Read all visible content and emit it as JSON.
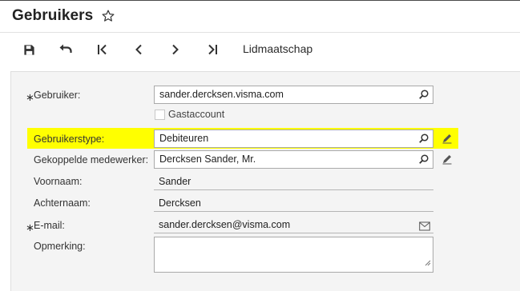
{
  "header": {
    "title": "Gebruikers",
    "star_icon": "star-outline-icon"
  },
  "toolbar": {
    "buttons": [
      {
        "name": "save",
        "icon": "save-icon"
      },
      {
        "name": "undo",
        "icon": "undo-icon"
      },
      {
        "name": "first",
        "icon": "first-record-icon"
      },
      {
        "name": "previous",
        "icon": "previous-record-icon"
      },
      {
        "name": "next",
        "icon": "next-record-icon"
      },
      {
        "name": "last",
        "icon": "last-record-icon"
      }
    ],
    "membership_label": "Lidmaatschap"
  },
  "form": {
    "user": {
      "required_marker": "∗",
      "label": "Gebruiker:",
      "value": "sander.dercksen.visma.com",
      "icon": "search-icon"
    },
    "guest": {
      "label": "Gastaccount",
      "checked": false
    },
    "user_type": {
      "label": "Gebruikerstype:",
      "value": "Debiteuren",
      "icon": "search-icon",
      "action_icon": "pencil-icon"
    },
    "linked_employee": {
      "label": "Gekoppelde medewerker:",
      "value": "Dercksen Sander, Mr.",
      "icon": "search-icon",
      "action_icon": "pencil-icon"
    },
    "first_name": {
      "label": "Voornaam:",
      "value": "Sander"
    },
    "last_name": {
      "label": "Achternaam:",
      "value": "Dercksen"
    },
    "email": {
      "required_marker": "∗",
      "label": "E-mail:",
      "value": "sander.dercksen@visma.com",
      "icon": "envelope-icon"
    },
    "remark": {
      "label": "Opmerking:",
      "value": ""
    }
  },
  "colors": {
    "highlight": "#ffff00",
    "panel_background": "#f4f4f4",
    "icon_dark": "#333333"
  }
}
